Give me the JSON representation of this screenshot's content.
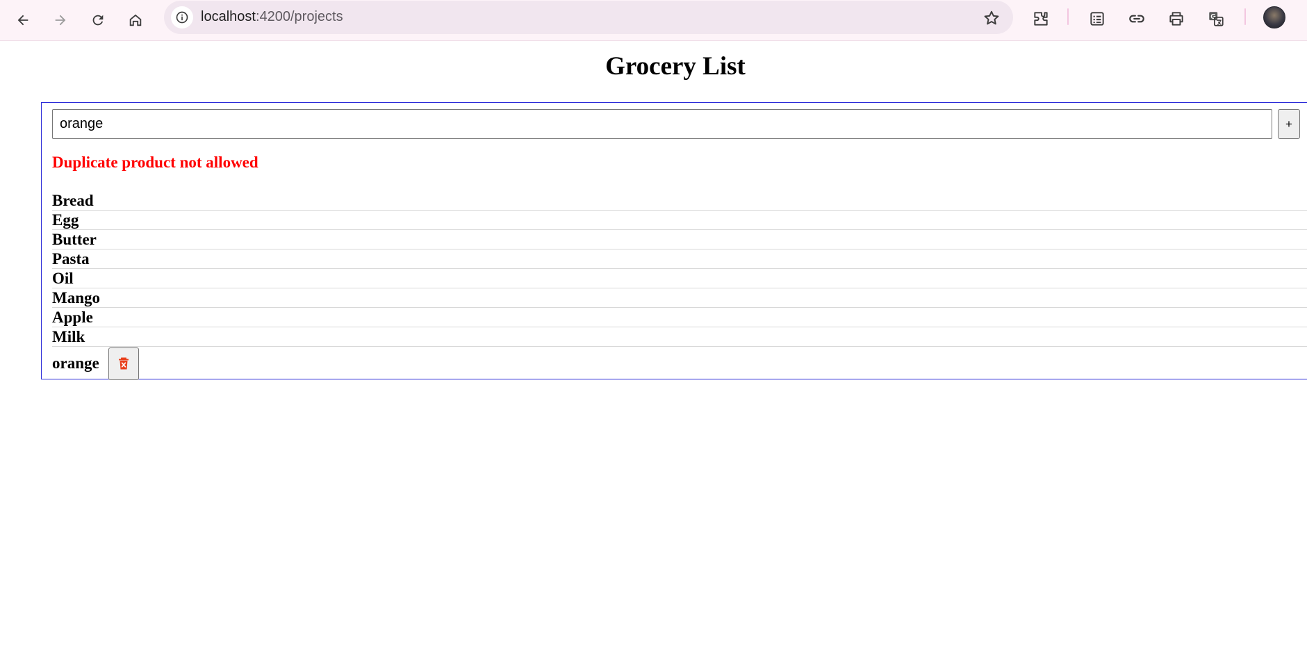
{
  "browser": {
    "url_host": "localhost",
    "url_path": ":4200/projects",
    "icons": [
      "back-icon",
      "forward-icon",
      "reload-icon",
      "home-icon",
      "site-info-icon",
      "bookmark-star-icon",
      "extensions-icon",
      "reading-list-icon",
      "link-icon",
      "print-icon",
      "translate-icon",
      "profile-avatar"
    ]
  },
  "page": {
    "title": "Grocery List"
  },
  "form": {
    "input_value": "orange",
    "add_label": "+"
  },
  "error": {
    "message": "Duplicate product not allowed",
    "color": "#ff0000"
  },
  "items": [
    "Bread",
    "Egg",
    "Butter",
    "Pasta",
    "Oil",
    "Mango",
    "Apple",
    "Milk",
    "orange"
  ],
  "colors": {
    "container_border": "#2a2ad8",
    "toolbar_bg": "#fdf3f8",
    "omnibox_bg": "#f1e6ef",
    "delete_icon": "#e8401c"
  }
}
